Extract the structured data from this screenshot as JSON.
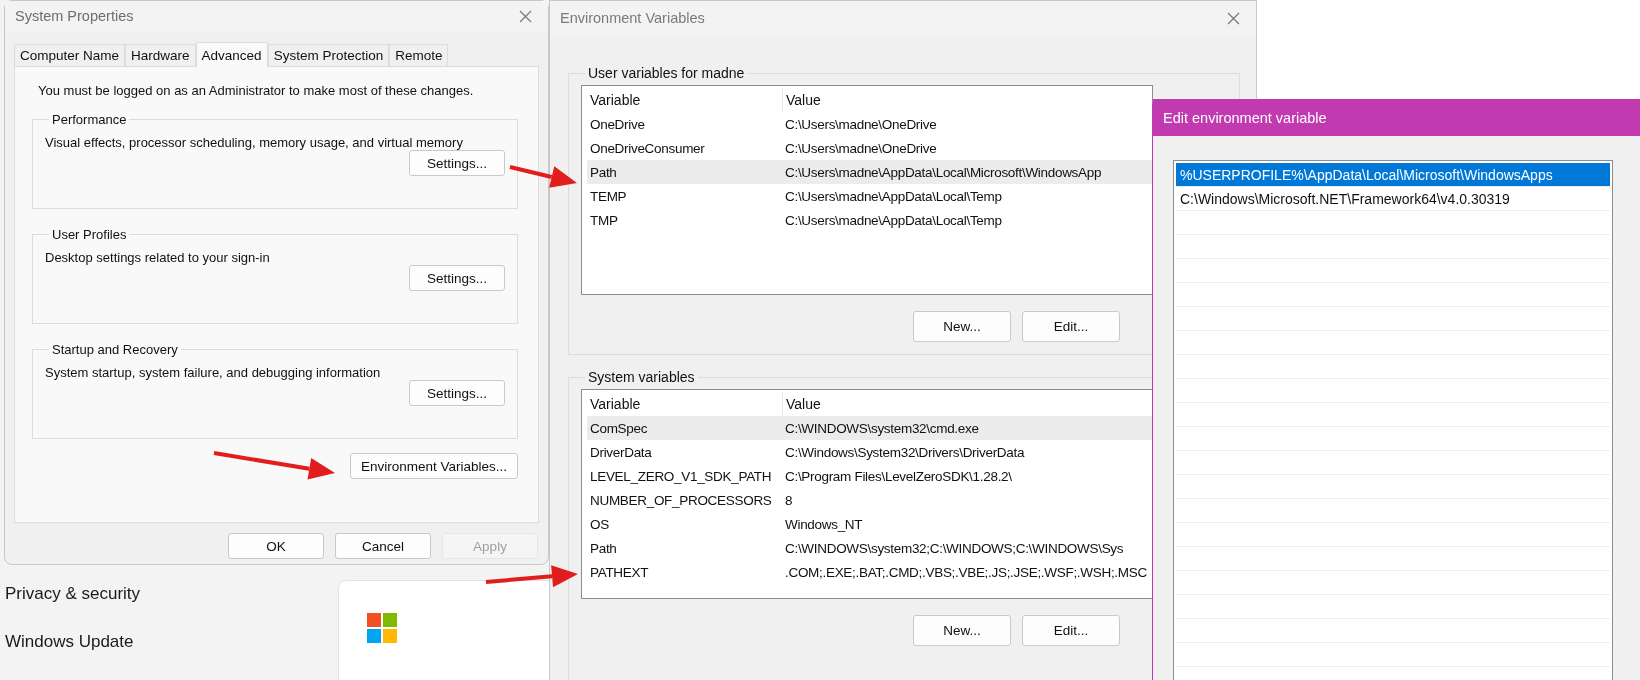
{
  "settings_background": {
    "nav_items": [
      "Privacy & security",
      "Windows Update"
    ]
  },
  "system_properties": {
    "title": "System Properties",
    "tabs": [
      {
        "label": "Computer Name",
        "selected": false
      },
      {
        "label": "Hardware",
        "selected": false
      },
      {
        "label": "Advanced",
        "selected": true
      },
      {
        "label": "System Protection",
        "selected": false
      },
      {
        "label": "Remote",
        "selected": false
      }
    ],
    "notice": "You must be logged on as an Administrator to make most of these changes.",
    "groups": [
      {
        "title": "Performance",
        "description": "Visual effects, processor scheduling, memory usage, and virtual memory",
        "button": "Settings..."
      },
      {
        "title": "User Profiles",
        "description": "Desktop settings related to your sign-in",
        "button": "Settings..."
      },
      {
        "title": "Startup and Recovery",
        "description": "System startup, system failure, and debugging information",
        "button": "Settings..."
      }
    ],
    "env_button": "Environment Variables...",
    "buttons": [
      {
        "label": "OK",
        "disabled": false
      },
      {
        "label": "Cancel",
        "disabled": false
      },
      {
        "label": "Apply",
        "disabled": true
      }
    ]
  },
  "environment_variables": {
    "title": "Environment Variables",
    "sections": [
      {
        "title": "User variables for madne",
        "columns": [
          "Variable",
          "Value"
        ],
        "rows": [
          {
            "variable": "OneDrive",
            "value": "C:\\Users\\madne\\OneDrive",
            "selected": false
          },
          {
            "variable": "OneDriveConsumer",
            "value": "C:\\Users\\madne\\OneDrive",
            "selected": false
          },
          {
            "variable": "Path",
            "value": "C:\\Users\\madne\\AppData\\Local\\Microsoft\\WindowsApp",
            "selected": true
          },
          {
            "variable": "TEMP",
            "value": "C:\\Users\\madne\\AppData\\Local\\Temp",
            "selected": false
          },
          {
            "variable": "TMP",
            "value": "C:\\Users\\madne\\AppData\\Local\\Temp",
            "selected": false
          }
        ],
        "buttons": [
          "New...",
          "Edit..."
        ]
      },
      {
        "title": "System variables",
        "columns": [
          "Variable",
          "Value"
        ],
        "rows": [
          {
            "variable": "ComSpec",
            "value": "C:\\WINDOWS\\system32\\cmd.exe",
            "selected": true
          },
          {
            "variable": "DriverData",
            "value": "C:\\Windows\\System32\\Drivers\\DriverData",
            "selected": false
          },
          {
            "variable": "LEVEL_ZERO_V1_SDK_PATH",
            "value": "C:\\Program Files\\LevelZeroSDK\\1.28.2\\",
            "selected": false
          },
          {
            "variable": "NUMBER_OF_PROCESSORS",
            "value": "8",
            "selected": false
          },
          {
            "variable": "OS",
            "value": "Windows_NT",
            "selected": false
          },
          {
            "variable": "Path",
            "value": "C:\\WINDOWS\\system32;C:\\WINDOWS;C:\\WINDOWS\\Sys",
            "selected": false
          },
          {
            "variable": "PATHEXT",
            "value": ".COM;.EXE;.BAT;.CMD;.VBS;.VBE;.JS;.JSE;.WSF;.WSH;.MSC",
            "selected": false
          }
        ],
        "buttons": [
          "New...",
          "Edit..."
        ]
      }
    ]
  },
  "edit_variable": {
    "title": "Edit environment variable",
    "entries": [
      {
        "text": "%USERPROFILE%\\AppData\\Local\\Microsoft\\WindowsApps",
        "selected": true
      },
      {
        "text": "C:\\Windows\\Microsoft.NET\\Framework64\\v4.0.30319",
        "selected": false
      }
    ]
  }
}
